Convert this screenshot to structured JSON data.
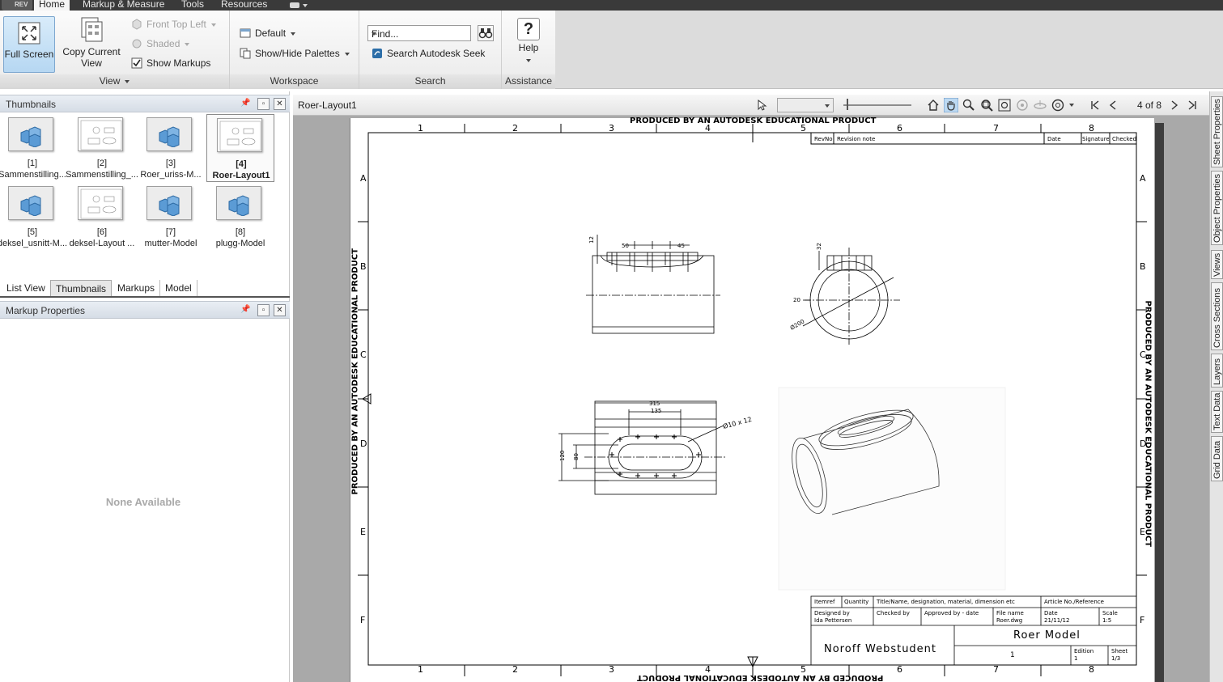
{
  "menubar": {
    "app_label": "REV",
    "items": [
      "Home",
      "Markup & Measure",
      "Tools",
      "Resources"
    ]
  },
  "ribbon": {
    "view": {
      "title": "View",
      "full_screen": "Full Screen",
      "copy_current_view_line1": "Copy Current",
      "copy_current_view_line2": "View",
      "front_top_left": "Front Top Left",
      "shaded": "Shaded",
      "show_markups": "Show Markups",
      "show_markups_checked": true
    },
    "workspace": {
      "title": "Workspace",
      "default": "Default",
      "show_hide_palettes": "Show/Hide Palettes"
    },
    "search": {
      "title": "Search",
      "find_value": "Find...",
      "search_seek": "Search Autodesk Seek"
    },
    "assistance": {
      "title": "Assistance",
      "help": "Help"
    }
  },
  "thumbnails_pane": {
    "title": "Thumbnails",
    "items": [
      {
        "num": "[1]",
        "label": "Sammenstilling...",
        "kind": "model"
      },
      {
        "num": "[2]",
        "label": "Sammenstilling_...",
        "kind": "layout"
      },
      {
        "num": "[3]",
        "label": "Roer_uriss-M...",
        "kind": "model"
      },
      {
        "num": "[4]",
        "label": "Roer-Layout1",
        "kind": "layout",
        "selected": true
      },
      {
        "num": "[5]",
        "label": "deksel_usnitt-M...",
        "kind": "model"
      },
      {
        "num": "[6]",
        "label": "deksel-Layout ...",
        "kind": "layout"
      },
      {
        "num": "[7]",
        "label": "mutter-Model",
        "kind": "model"
      },
      {
        "num": "[8]",
        "label": "plugg-Model",
        "kind": "model"
      }
    ],
    "tabs": [
      {
        "label": "List View",
        "active": false
      },
      {
        "label": "Thumbnails",
        "active": true
      },
      {
        "label": "Markups",
        "active": false
      },
      {
        "label": "Model",
        "active": false
      }
    ]
  },
  "markup_properties": {
    "title": "Markup Properties",
    "empty_text": "None Available"
  },
  "canvas": {
    "doc_title": "Roer-Layout1",
    "page_indicator": "4 of 8"
  },
  "right_dock": {
    "tabs": [
      "Sheet Properties",
      "Object Properties",
      "Views",
      "Cross Sections",
      "Layers",
      "Text Data",
      "Grid Data"
    ]
  },
  "drawing": {
    "watermark": "PRODUCED BY AN AUTODESK EDUCATIONAL PRODUCT",
    "columns": [
      "1",
      "2",
      "3",
      "4",
      "5",
      "6",
      "7",
      "8"
    ],
    "rows": [
      "A",
      "B",
      "C",
      "D",
      "E",
      "F"
    ],
    "revision_header": {
      "rev_no": "RevNo",
      "revision_note": "Revision note",
      "date": "Date",
      "signature": "Signature",
      "checked": "Checked"
    },
    "dims": {
      "d12": "12",
      "d50": "50",
      "d45": "45",
      "d32": "32",
      "d20": "20",
      "d200": "Ø200",
      "d315": "315",
      "d135": "135",
      "d10x12": "Ø10 x 12",
      "d120": "120",
      "d80": "80"
    },
    "title_block": {
      "itemref": "Itemref",
      "quantity": "Quantity",
      "title_name": "Title/Name, designation, material, dimension etc",
      "article_no": "Article No./Reference",
      "designed_by_label": "Designed by",
      "designed_by": "Ida Pettersen",
      "checked_by_label": "Checked by",
      "approved_by_label": "Approved by - date",
      "file_name_label": "File name",
      "file_name": "Roer.dwg",
      "date_label": "Date",
      "date": "21/11/12",
      "scale_label": "Scale",
      "scale": "1:5",
      "drawing_title": "Roer Model",
      "company": "Noroff Webstudent",
      "number": "1",
      "edition_label": "Edition",
      "edition": "1",
      "sheet_label": "Sheet",
      "sheet": "1/3"
    }
  }
}
